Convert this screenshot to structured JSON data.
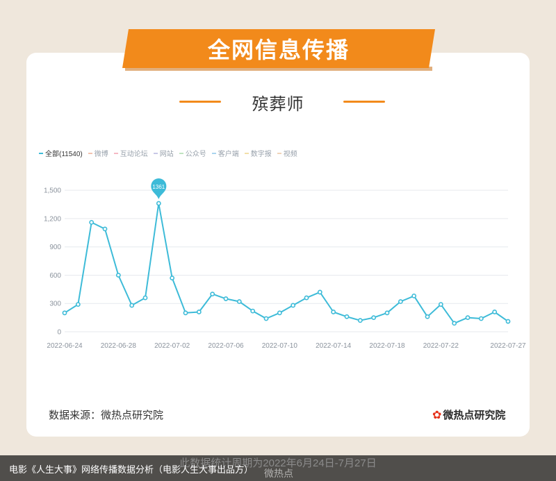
{
  "header": {
    "title": "全网信息传播"
  },
  "subtitle": "殡葬师",
  "legend": [
    {
      "label": "全部(11540)",
      "color": "#3dbbd8",
      "active": true
    },
    {
      "label": "微博",
      "color": "#f3c3b0",
      "active": false
    },
    {
      "label": "互动论坛",
      "color": "#f5b8c4",
      "active": false
    },
    {
      "label": "网站",
      "color": "#c8c8e6",
      "active": false
    },
    {
      "label": "公众号",
      "color": "#bfe3c0",
      "active": false
    },
    {
      "label": "客户端",
      "color": "#a9d4ef",
      "active": false
    },
    {
      "label": "数字报",
      "color": "#f3dfa8",
      "active": false
    },
    {
      "label": "视频",
      "color": "#f1d4b8",
      "active": false
    }
  ],
  "chart_data": {
    "type": "line",
    "x": [
      "2022-06-24",
      "2022-06-25",
      "2022-06-26",
      "2022-06-27",
      "2022-06-28",
      "2022-06-29",
      "2022-06-30",
      "2022-07-01",
      "2022-07-02",
      "2022-07-03",
      "2022-07-04",
      "2022-07-05",
      "2022-07-06",
      "2022-07-07",
      "2022-07-08",
      "2022-07-09",
      "2022-07-10",
      "2022-07-11",
      "2022-07-12",
      "2022-07-13",
      "2022-07-14",
      "2022-07-15",
      "2022-07-16",
      "2022-07-17",
      "2022-07-18",
      "2022-07-19",
      "2022-07-20",
      "2022-07-21",
      "2022-07-22",
      "2022-07-23",
      "2022-07-24",
      "2022-07-25",
      "2022-07-26",
      "2022-07-27"
    ],
    "x_tick_labels": [
      "2022-06-24",
      "2022-06-28",
      "2022-07-02",
      "2022-07-06",
      "2022-07-10",
      "2022-07-14",
      "2022-07-18",
      "2022-07-22",
      "2022-07-27"
    ],
    "series": [
      {
        "name": "全部",
        "color": "#3dbbd8",
        "values": [
          200,
          290,
          1160,
          1090,
          600,
          280,
          360,
          1361,
          570,
          200,
          210,
          400,
          350,
          320,
          220,
          140,
          200,
          280,
          360,
          420,
          210,
          160,
          120,
          150,
          200,
          320,
          380,
          160,
          290,
          90,
          150,
          140,
          210,
          110
        ]
      }
    ],
    "y_ticks": [
      0,
      300,
      600,
      900,
      1200,
      1500
    ],
    "y_tick_labels": [
      "0",
      "300",
      "600",
      "900",
      "1,200",
      "1,500"
    ],
    "ylim": [
      0,
      1560
    ],
    "grid": true,
    "peak_label": "1361",
    "peak_index": 7
  },
  "footer": {
    "source": "数据来源：微热点研究院",
    "logo": "微热点研究院",
    "period": "此数据统计周期为2022年6月24日-7月27日",
    "caption": "电影《人生大事》网络传播数据分析（电影人生大事出品方）",
    "watermark": "微热点"
  }
}
